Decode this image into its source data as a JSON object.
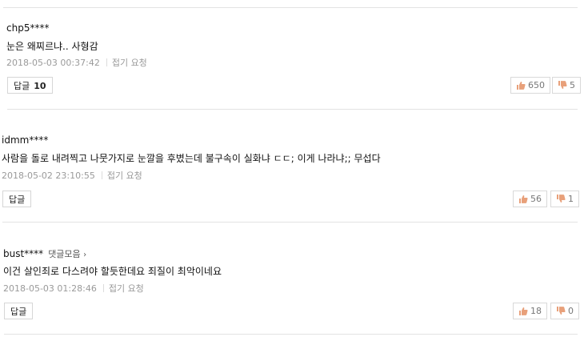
{
  "comments": [
    {
      "author": "chp5****",
      "text": "눈은 왜찌르냐.. 사형감",
      "timestamp": "2018-05-03 00:37:42",
      "report_label": "접기 요청",
      "reply_label": "답글",
      "reply_count": "10",
      "likes": "650",
      "dislikes": "5"
    },
    {
      "author": "idmm****",
      "text": "사람을 돌로 내려찍고 나뭇가지로 눈깔을 후볐는데 불구속이 실화냐 ㄷㄷ; 이게 나라냐;; 무섭다",
      "timestamp": "2018-05-02 23:10:55",
      "report_label": "접기 요청",
      "reply_label": "답글",
      "likes": "56",
      "dislikes": "1"
    },
    {
      "author": "bust****",
      "more_label": "댓글모음",
      "text": "이건 살인죄로 다스려야 할듯한데요 죄질이 최악이네요",
      "timestamp": "2018-05-03 01:28:46",
      "report_label": "접기 요청",
      "reply_label": "답글",
      "likes": "18",
      "dislikes": "0"
    }
  ],
  "colors": {
    "like_icon": "#e8a07a",
    "dislike_icon": "#e8a07a",
    "meta_text": "#9a9a9a",
    "divider": "#e3e3e3"
  },
  "icons": {
    "like": "thumbs-up-icon",
    "dislike": "thumbs-down-icon",
    "more": "chevron-right-icon"
  }
}
